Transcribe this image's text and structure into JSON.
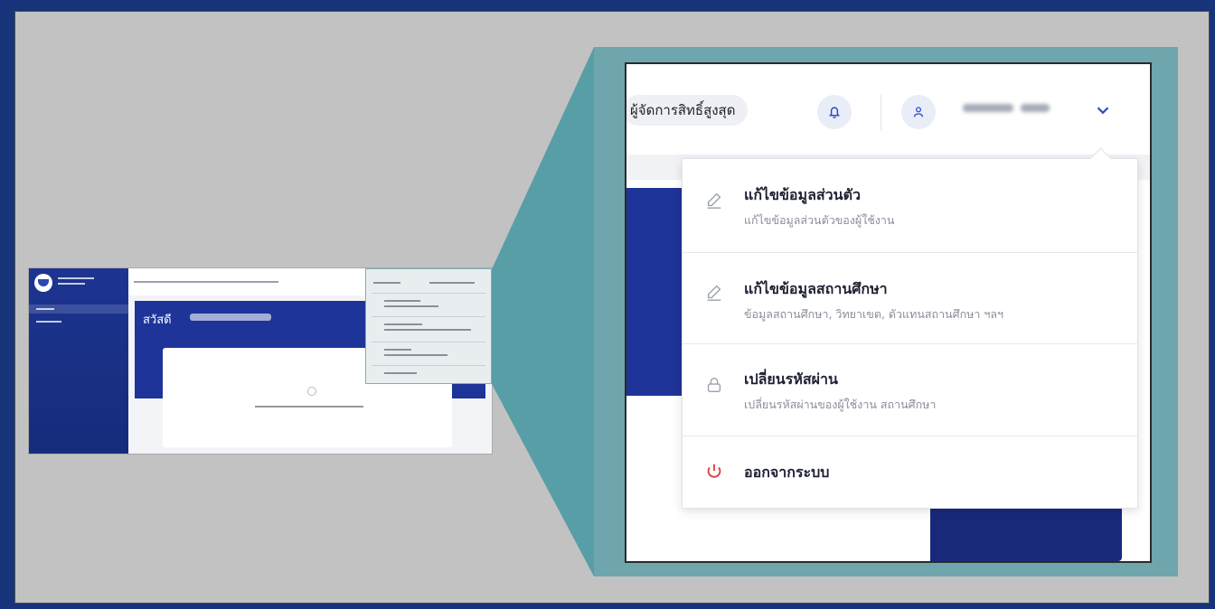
{
  "colors": {
    "primary": "#1e3499",
    "accent_teal": "#6fa5ad",
    "logout_red": "#e23b3b",
    "icon_blue": "#2d4bc4"
  },
  "zoom": {
    "role_label": "ผู้จัดการสิทธิ์สูงสุด",
    "notification_icon": "bell-icon",
    "user_icon": "user-icon",
    "user_menu_icon": "chevron-down-icon",
    "menu": {
      "items": [
        {
          "title": "แก้ไขข้อมูลส่วนตัว",
          "subtitle": "แก้ไขข้อมูลส่วนตัวของผู้ใช้งาน",
          "icon": "pencil-icon"
        },
        {
          "title": "แก้ไขข้อมูลสถานศึกษา",
          "subtitle": "ข้อมูลสถานศึกษา, วิทยาเขต, ตัวแทนสถานศึกษา ฯลฯ",
          "icon": "pencil-icon"
        },
        {
          "title": "เปลี่ยนรหัสผ่าน",
          "subtitle": "เปลี่ยนรหัสผ่านของผู้ใช้งาน สถานศึกษา",
          "icon": "lock-icon"
        }
      ],
      "logout": {
        "title": "ออกจากระบบ",
        "icon": "power-icon"
      }
    }
  },
  "mini": {
    "greeting": "สวัสดี"
  }
}
